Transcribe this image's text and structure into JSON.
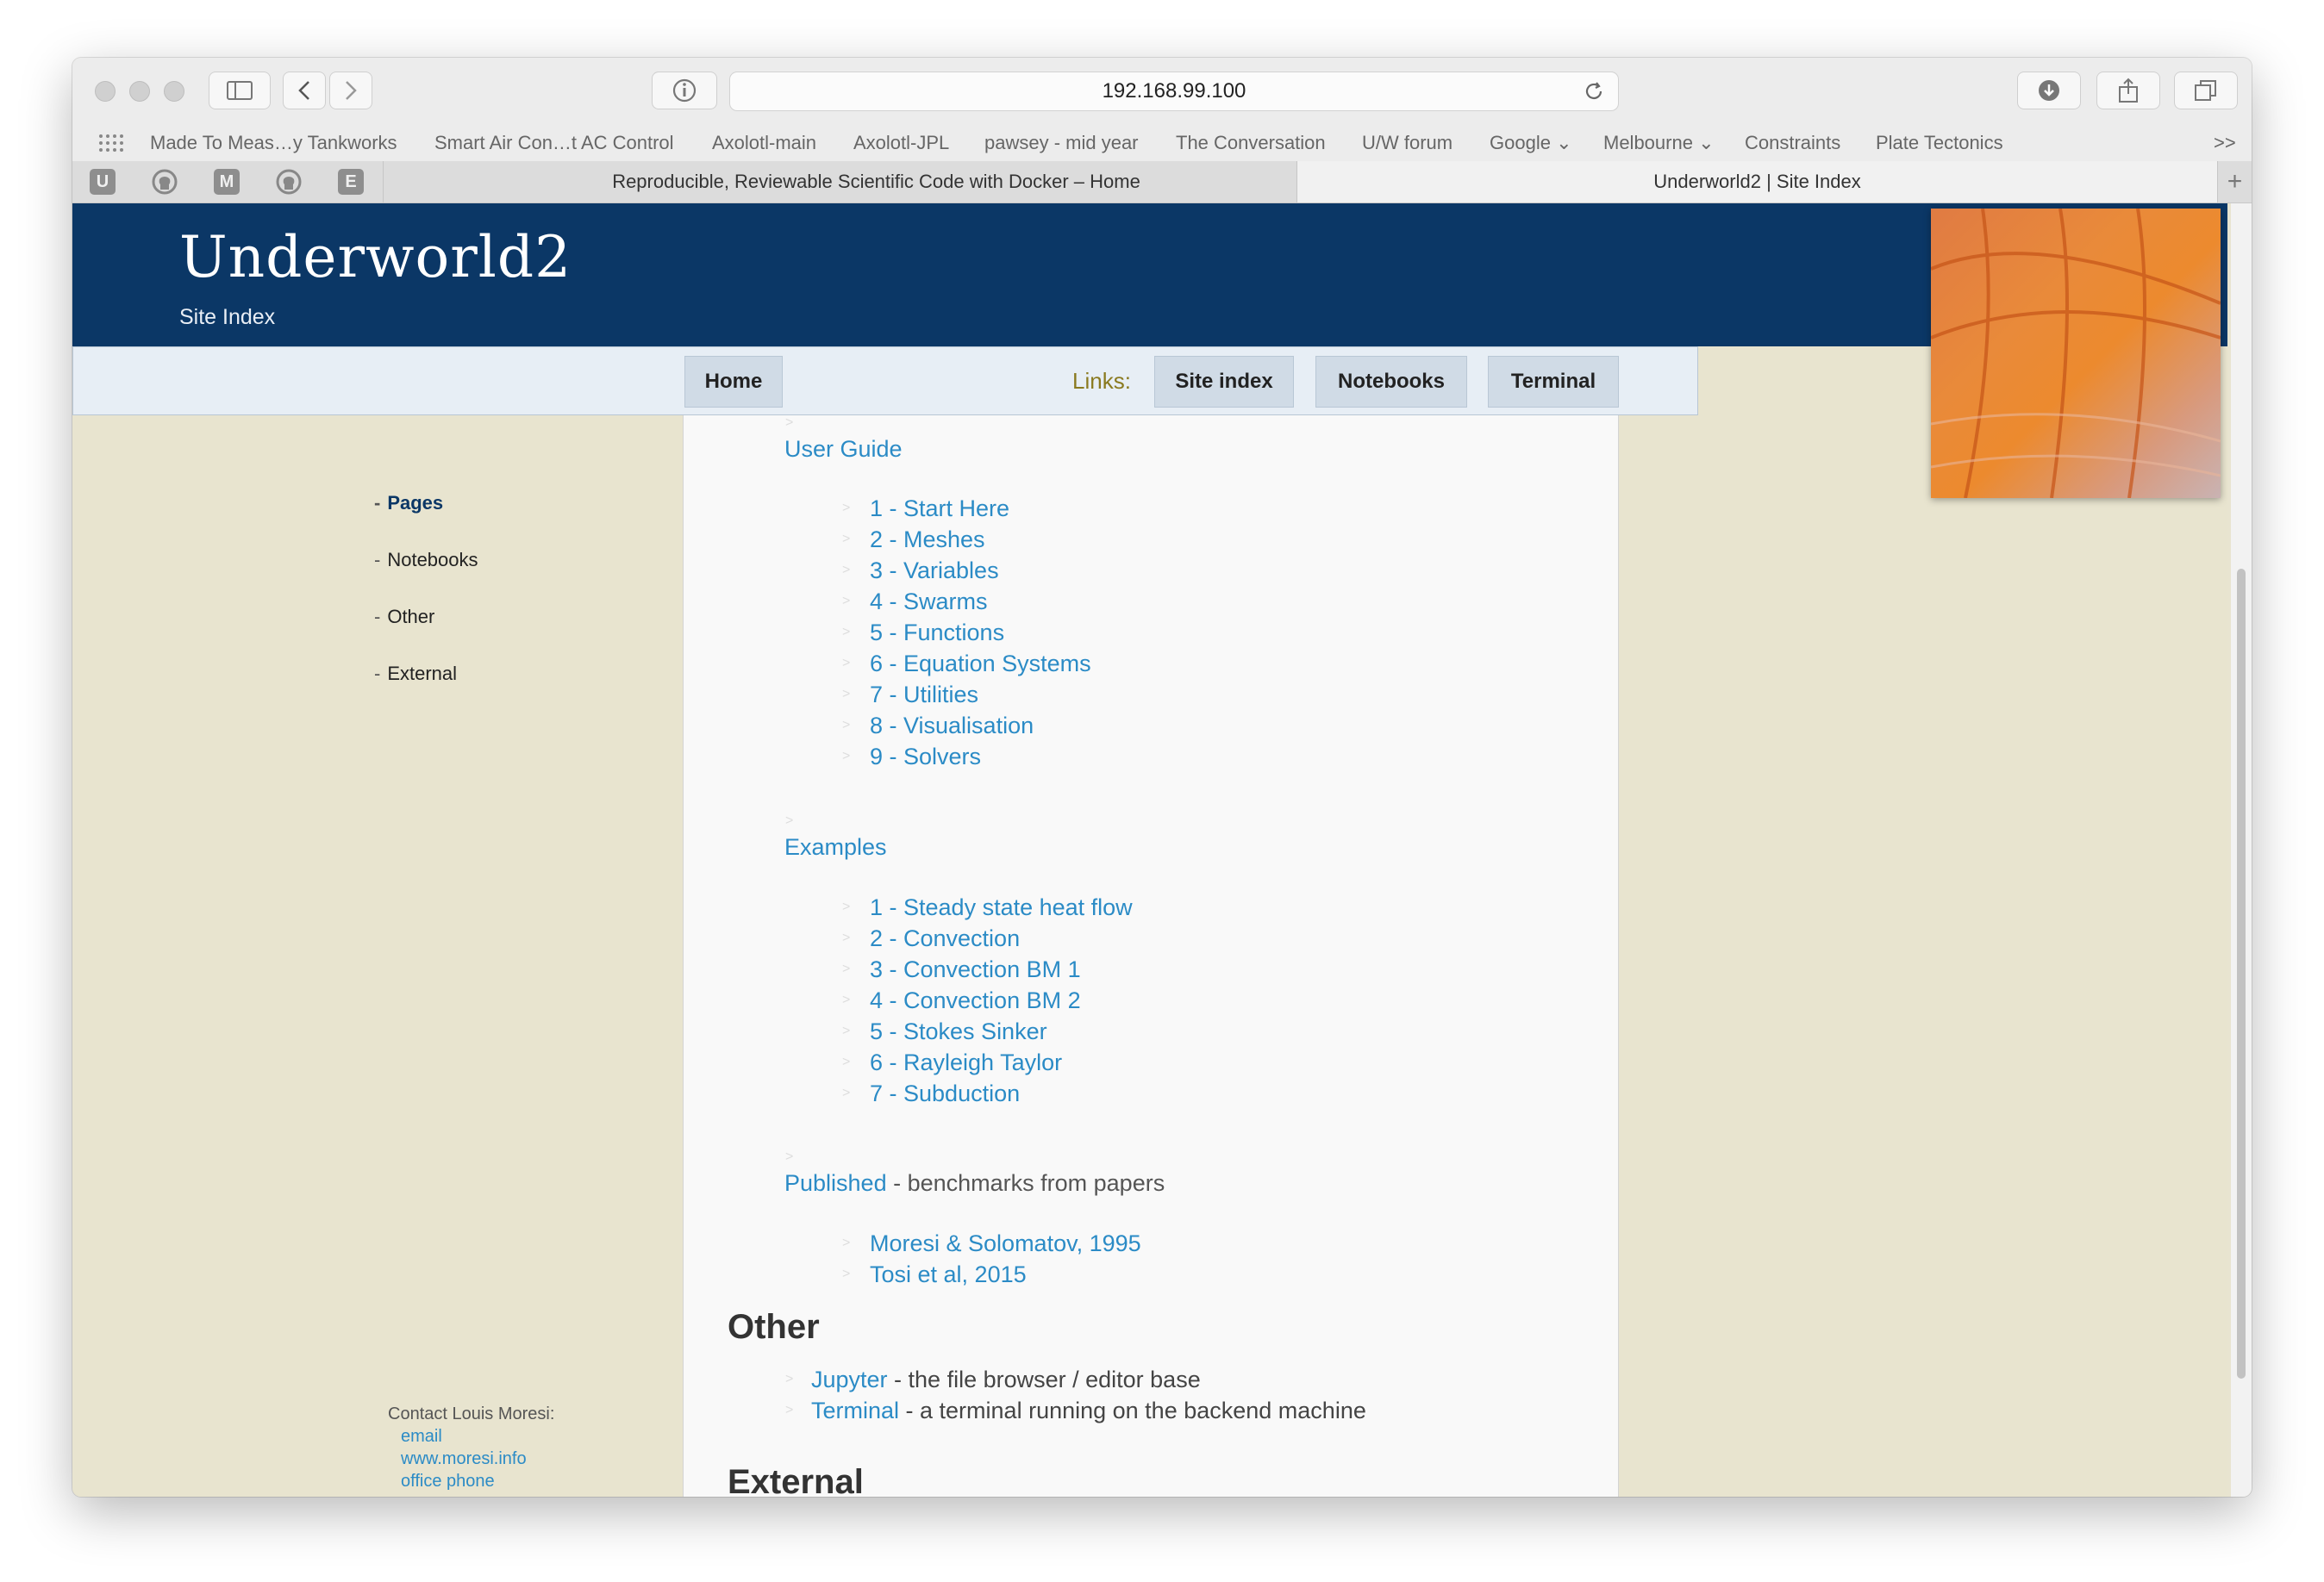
{
  "browser": {
    "url": "192.168.99.100",
    "bookmarks": [
      "Made To Meas…y Tankworks",
      "Smart Air Con…t AC Control",
      "Axolotl-main",
      "Axolotl-JPL",
      "pawsey - mid year",
      "The Conversation",
      "U/W forum",
      "Google",
      "Melbourne",
      "Constraints",
      "Plate Tectonics"
    ],
    "overflow": ">>",
    "pinned": [
      "U",
      "M",
      "E"
    ],
    "tabs": [
      "Reproducible, Reviewable Scientific Code with Docker – Home",
      "Underworld2 | Site Index"
    ]
  },
  "site": {
    "title": "Underworld2",
    "subtitle": "Site Index"
  },
  "nav": {
    "home": "Home",
    "links_label": "Links:",
    "site_index": "Site index",
    "notebooks": "Notebooks",
    "terminal": "Terminal"
  },
  "sidebar": {
    "items": [
      "Pages",
      "Notebooks",
      "Other",
      "External"
    ],
    "dash": "-"
  },
  "contact": {
    "label": "Contact Louis Moresi:",
    "email": "email",
    "website": "www.moresi.info",
    "phone": "office phone"
  },
  "content": {
    "caret": ">",
    "user_guide": {
      "title": "User Guide",
      "items": [
        "1 - Start Here",
        "2 - Meshes",
        "3 - Variables",
        "4 - Swarms",
        "5 - Functions",
        "6 - Equation Systems",
        "7 - Utilities",
        "8 - Visualisation",
        "9 - Solvers"
      ]
    },
    "examples": {
      "title": "Examples",
      "items": [
        "1 - Steady state heat flow",
        "2 - Convection",
        "3 - Convection BM 1",
        "4 - Convection BM 2",
        "5 - Stokes Sinker",
        "6 - Rayleigh Taylor",
        "7 - Subduction"
      ]
    },
    "published": {
      "title": "Published",
      "suffix": " - benchmarks from papers",
      "items": [
        "Moresi & Solomatov, 1995",
        "Tosi et al, 2015"
      ]
    },
    "other": {
      "heading": "Other",
      "items": [
        {
          "link": "Jupyter",
          "text": " - the file browser / editor base"
        },
        {
          "link": "Terminal",
          "text": " - a terminal running on the backend machine"
        }
      ]
    },
    "external_heading": "External"
  }
}
